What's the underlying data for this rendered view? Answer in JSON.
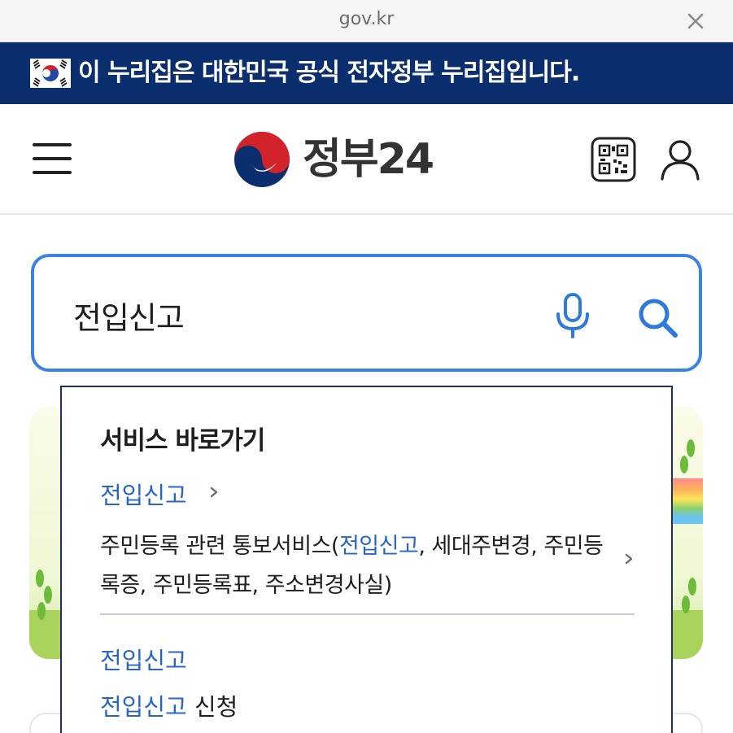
{
  "browser": {
    "url": "gov.kr"
  },
  "gov_banner": {
    "text": "이 누리집은 대한민국 공식 전자정부 누리집입니다."
  },
  "header": {
    "logo_text": "정부24"
  },
  "search": {
    "value": "전입신고"
  },
  "dropdown": {
    "title": "서비스 바로가기",
    "service_link": "전입신고",
    "service_desc": {
      "prefix": "주민등록 관련 통보서비스(",
      "highlight": "전입신고",
      "suffix": ", 세대주변경, 주민등록증, 주민등록표, 주소변경사실)"
    },
    "suggestions": [
      {
        "highlight": "전입신고",
        "rest": ""
      },
      {
        "highlight": "전입신고",
        "rest": " 신청"
      }
    ]
  },
  "colors": {
    "banner_bg": "#0b2e6f",
    "accent": "#3b82e6",
    "link": "#2866c6"
  }
}
